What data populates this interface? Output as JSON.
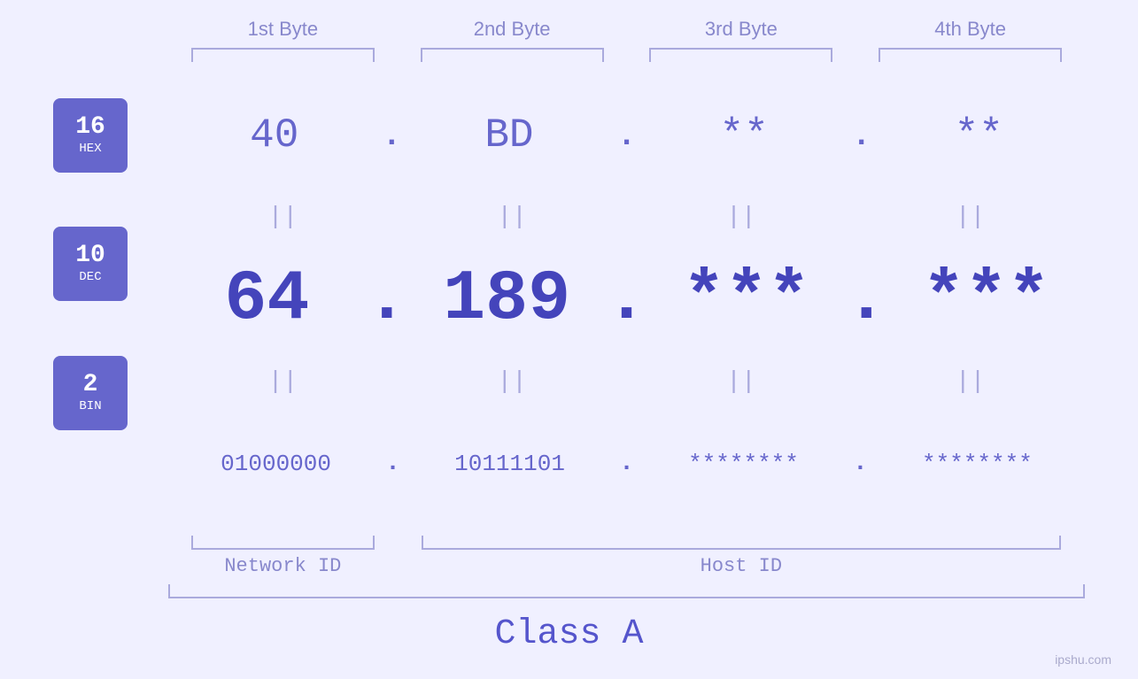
{
  "byteHeaders": {
    "b1": "1st Byte",
    "b2": "2nd Byte",
    "b3": "3rd Byte",
    "b4": "4th Byte"
  },
  "badges": {
    "hex": {
      "number": "16",
      "label": "HEX"
    },
    "dec": {
      "number": "10",
      "label": "DEC"
    },
    "bin": {
      "number": "2",
      "label": "BIN"
    }
  },
  "hexRow": {
    "b1": "40",
    "b2": "BD",
    "b3": "**",
    "b4": "**"
  },
  "decRow": {
    "b1": "64",
    "b2": "189",
    "b3": "***",
    "b4": "***"
  },
  "binRow": {
    "b1": "01000000",
    "b2": "10111101",
    "b3": "********",
    "b4": "********"
  },
  "labels": {
    "networkId": "Network ID",
    "hostId": "Host ID",
    "classA": "Class A"
  },
  "watermark": "ipshu.com"
}
